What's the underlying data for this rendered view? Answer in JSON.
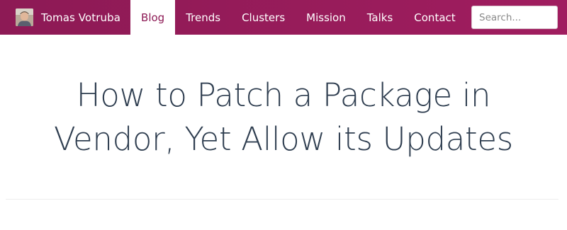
{
  "navbar": {
    "brand_name": "Tomas Votruba",
    "items": [
      {
        "label": "Blog",
        "active": true
      },
      {
        "label": "Trends",
        "active": false
      },
      {
        "label": "Clusters",
        "active": false
      },
      {
        "label": "Mission",
        "active": false
      },
      {
        "label": "Talks",
        "active": false
      },
      {
        "label": "Contact",
        "active": false
      }
    ],
    "search_placeholder": "Search...",
    "colors": {
      "bar": "#8d1a55",
      "active_text": "#8d1a55",
      "text": "#ffffff"
    }
  },
  "main": {
    "title_line1": "How to Patch a Package in",
    "title_line2": "Vendor, Yet Allow its Updates",
    "title_color": "#2f3e50"
  }
}
